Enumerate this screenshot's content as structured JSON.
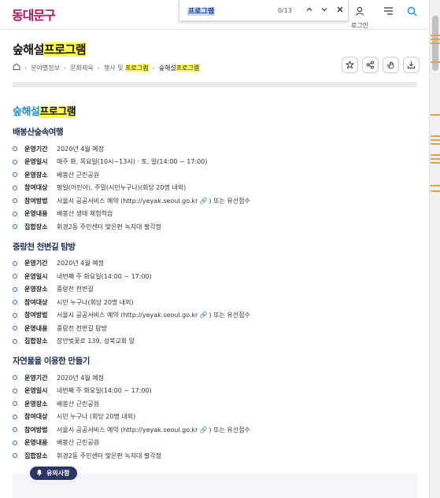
{
  "header": {
    "logo": "동대문구",
    "login_label": "로그인"
  },
  "findbar": {
    "query": "프로그램",
    "count": "0/13"
  },
  "page": {
    "title_pre": "숲해설",
    "title_hl": "프로그램"
  },
  "breadcrumb": {
    "items": [
      "분야별정보",
      "문화체육",
      "행사 및 ",
      "숲해설"
    ],
    "hl_3": "프로그램",
    "hl_4": "프로그램"
  },
  "section": {
    "title_pre": "숲해설",
    "title_hl": "프로그램"
  },
  "programs": [
    {
      "title": "배봉산숲속여행",
      "rows": [
        {
          "label": "운영기간",
          "value": "2020년 4월 예정"
        },
        {
          "label": "운영일시",
          "value": "매주 화, 목요일(10시~13시) · 토, 일(14:00 ~ 17:00)"
        },
        {
          "label": "운영장소",
          "value": "배봉산 근린공원"
        },
        {
          "label": "참여대상",
          "value": "평일(어린이), 주말(시민누구나)(회당 20명 내외)"
        },
        {
          "label": "참여방법",
          "value": "서울시 공공서비스 예약 (http://yeyak.seoul.go.kr",
          "value_after": ") 또는 유선접수",
          "link": true
        },
        {
          "label": "운영내용",
          "value": "배봉산 생태 체험학습"
        },
        {
          "label": "집합장소",
          "value": "휘경2동 주민센터 맞은편 녹지대 팔각정"
        }
      ]
    },
    {
      "title": "중랑천 천변길 탐방",
      "rows": [
        {
          "label": "운영기간",
          "value": "2020년 4월 예정"
        },
        {
          "label": "운영일시",
          "value": "네번째 주 화요일(14:00 ~ 17:00)"
        },
        {
          "label": "운영장소",
          "value": "중랑천 천변길"
        },
        {
          "label": "참여대상",
          "value": "시민 누구나(회당 20명 내외)"
        },
        {
          "label": "참여방법",
          "value": "서울시 공공서비스 예약 (http://yeyak.seoul.go.kr",
          "value_after": ") 또는 유선접수",
          "link": true
        },
        {
          "label": "운영내용",
          "value": "중랑천 천변길 탐방"
        },
        {
          "label": "집합장소",
          "value": "장안벚꽃로 139, 성북교회 앞"
        }
      ]
    },
    {
      "title": "자연물을 이용한 만들기",
      "rows": [
        {
          "label": "운영기간",
          "value": "2020년 4월 예정"
        },
        {
          "label": "운영일시",
          "value": "네번째 주 화요일(14:00 ~ 17:00)"
        },
        {
          "label": "운영장소",
          "value": "배봉산 근린공원"
        },
        {
          "label": "참여대상",
          "value": "시민 누구나 (회당 20명 내외)"
        },
        {
          "label": "참여방법",
          "value": "서울시 공공서비스 예약 (http://yeyak.seoul.go.kr",
          "value_after": ") 또는 유선접수",
          "link": true
        },
        {
          "label": "운영내용",
          "value": "배봉산 근린공원"
        },
        {
          "label": "집합장소",
          "value": "휘경2동 주민센터 맞은편 녹지대 팔각정"
        }
      ]
    }
  ],
  "notice": {
    "label": "유의사항"
  },
  "colors": {
    "accent": "#1a8fdc",
    "highlight": "#ffff44",
    "brand": "#b0175f",
    "notice_bg": "#2a3566"
  }
}
